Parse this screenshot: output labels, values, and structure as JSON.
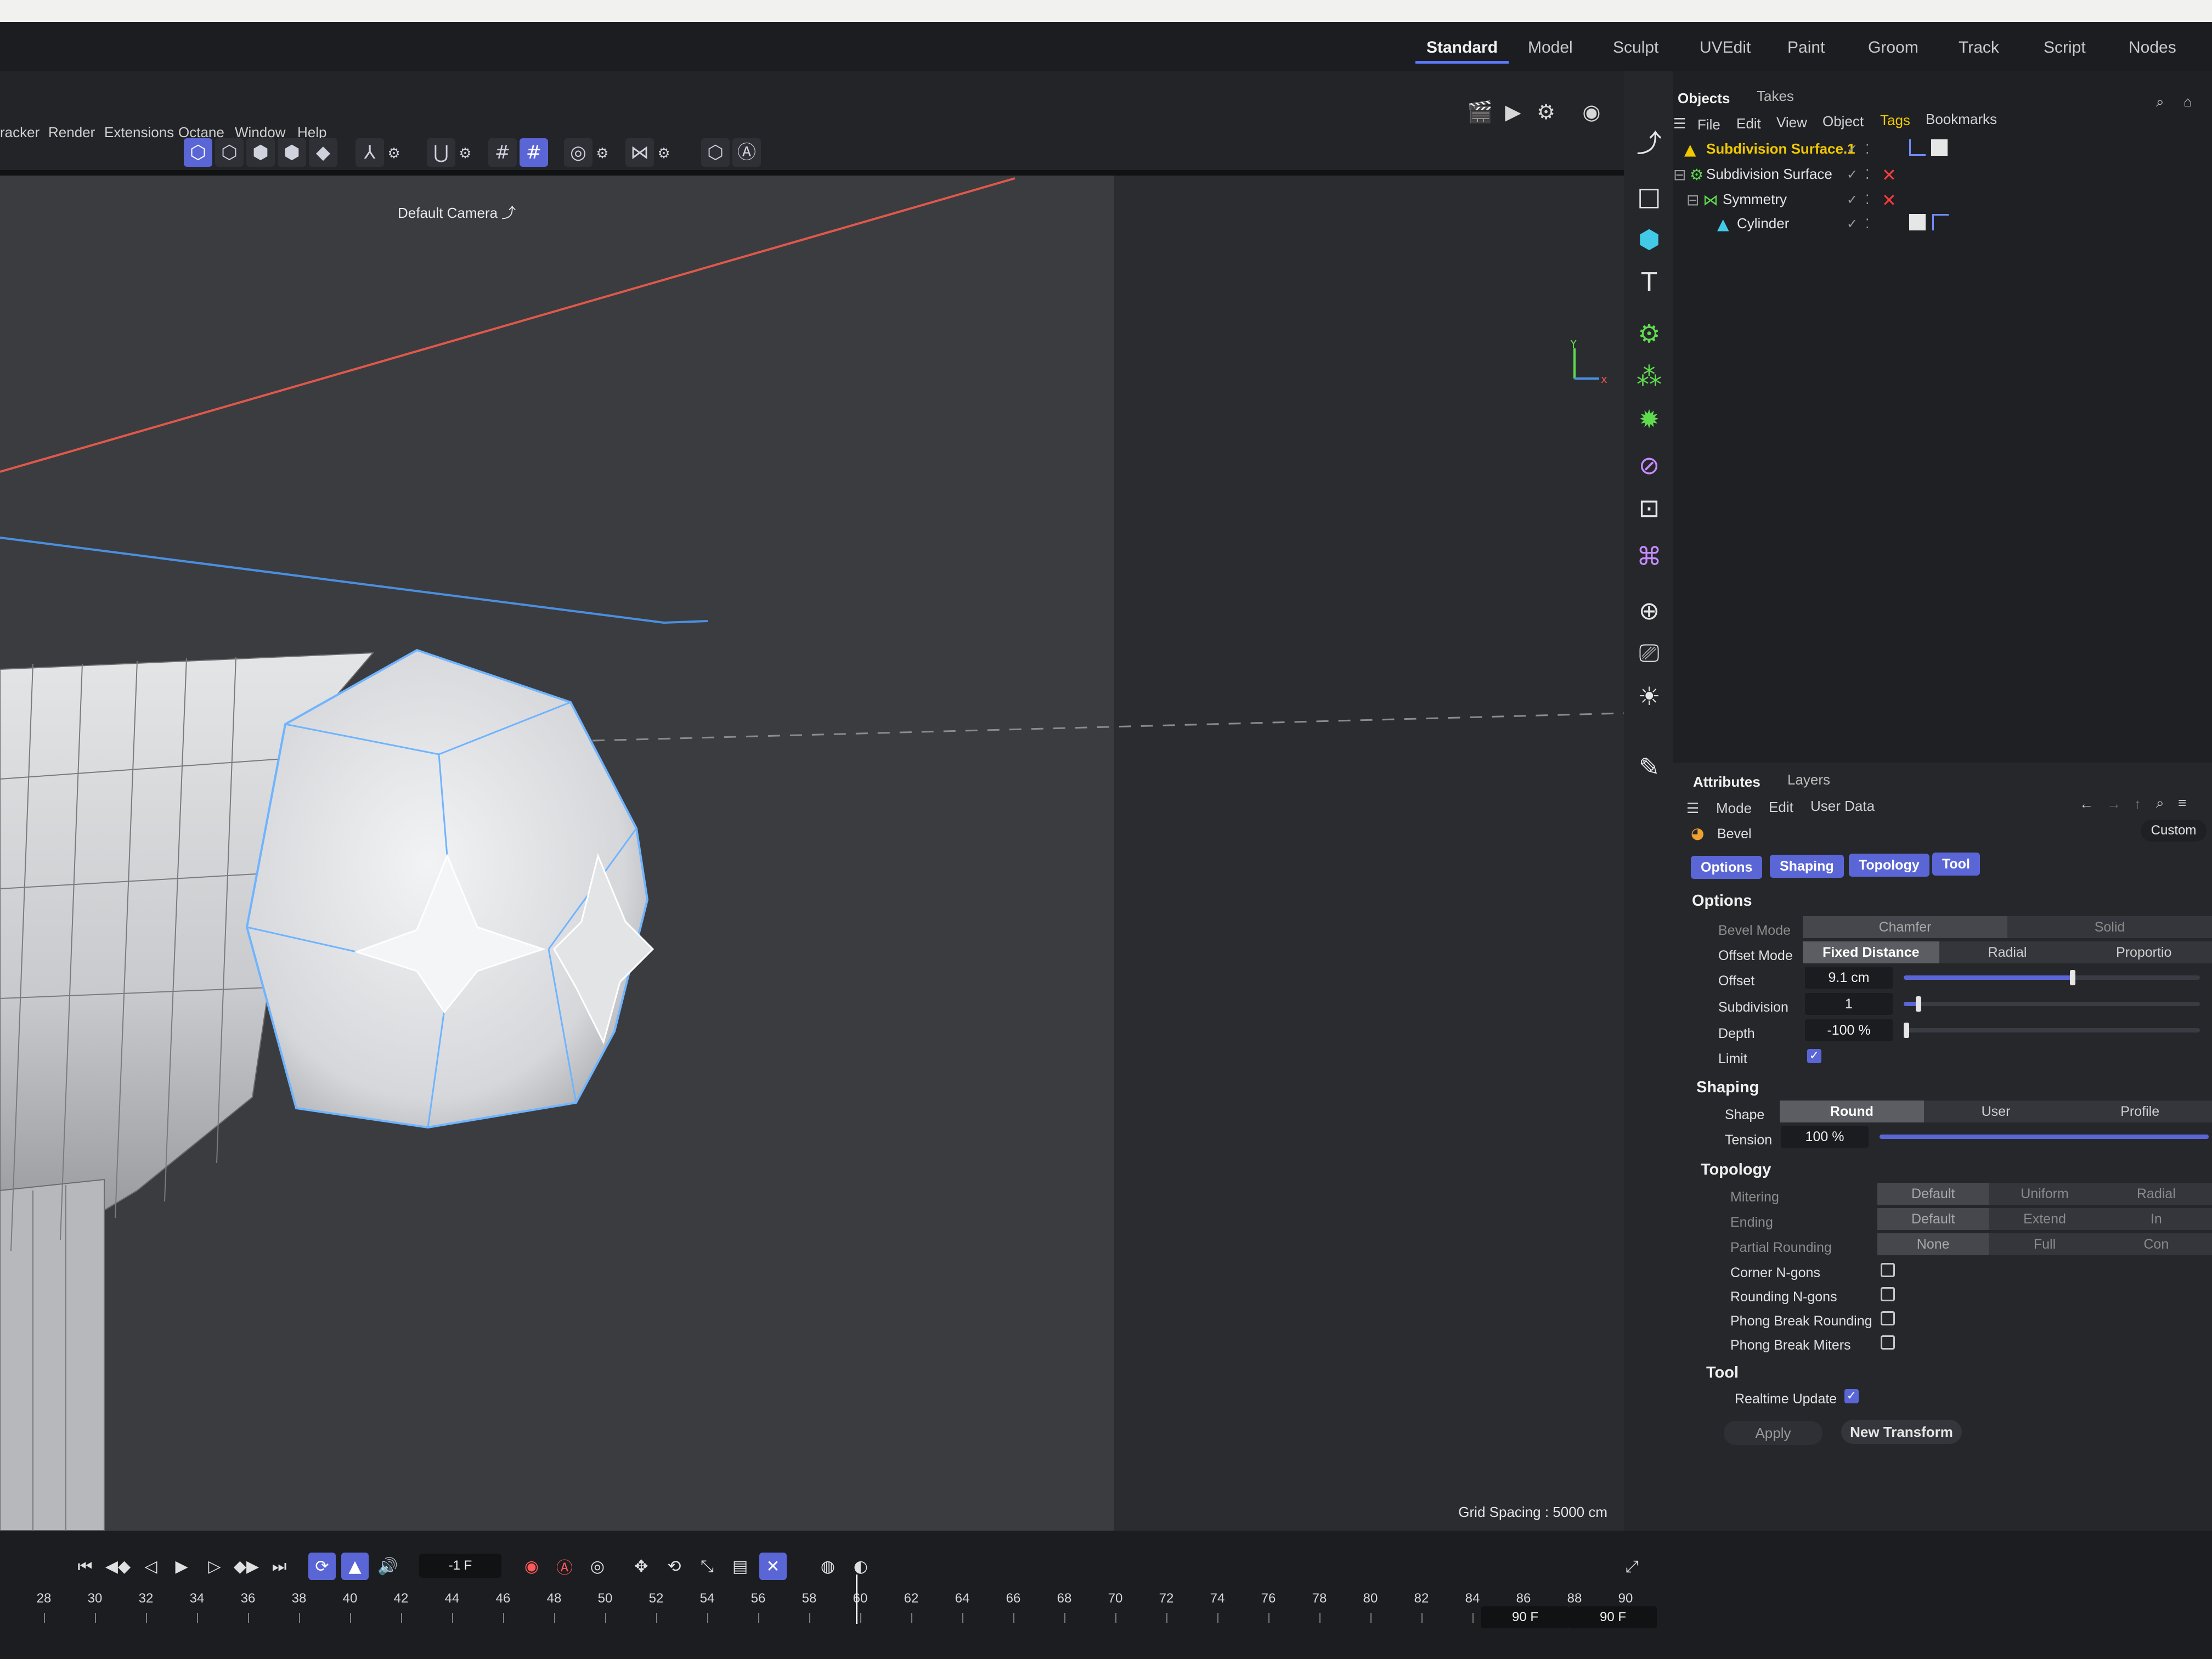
{
  "layouts": [
    "Standard",
    "Model",
    "Sculpt",
    "UVEdit",
    "Paint",
    "Groom",
    "Track",
    "Script",
    "Nodes"
  ],
  "active_layout": "Standard",
  "menubar": [
    "racker",
    "Render",
    "Extensions",
    "Octane",
    "Window",
    "Help"
  ],
  "viewport": {
    "camera": "Default Camera",
    "grid_spacing": "Grid Spacing : 5000 cm"
  },
  "objects_panel": {
    "tabs": [
      "Objects",
      "Takes"
    ],
    "menu": [
      "File",
      "Edit",
      "View",
      "Object",
      "Tags",
      "Bookmarks"
    ],
    "objects": [
      {
        "name": "Subdivision Surface.1",
        "selected": true
      },
      {
        "name": "Subdivision Surface",
        "selected": false
      },
      {
        "name": "Symmetry",
        "selected": false
      },
      {
        "name": "Cylinder",
        "selected": false
      }
    ]
  },
  "attributes": {
    "tabs": [
      "Attributes",
      "Layers"
    ],
    "menu": [
      "Mode",
      "Edit",
      "User Data"
    ],
    "mode_dropdown": "Custom",
    "tool_name": "Bevel",
    "chips": [
      "Options",
      "Shaping",
      "Topology",
      "Tool"
    ],
    "sections": {
      "options": "Options",
      "shaping": "Shaping",
      "topology": "Topology",
      "tool": "Tool"
    },
    "bevel_mode": {
      "label": "Bevel Mode",
      "options": [
        "Chamfer",
        "Solid"
      ],
      "selected": "Chamfer"
    },
    "offset_mode": {
      "label": "Offset Mode",
      "options": [
        "Fixed Distance",
        "Radial",
        "Proportio"
      ],
      "selected": "Fixed Distance"
    },
    "offset": {
      "label": "Offset",
      "value": "9.1 cm",
      "slider": 0.57
    },
    "subdivision": {
      "label": "Subdivision",
      "value": "1",
      "slider": 0.05
    },
    "depth": {
      "label": "Depth",
      "value": "-100 %",
      "slider": 0.0
    },
    "limit": {
      "label": "Limit",
      "checked": true
    },
    "shape": {
      "label": "Shape",
      "options": [
        "Round",
        "User",
        "Profile"
      ],
      "selected": "Round"
    },
    "tension": {
      "label": "Tension",
      "value": "100 %",
      "slider": 1.0
    },
    "mitering": {
      "label": "Mitering",
      "options": [
        "Default",
        "Uniform",
        "Radial"
      ],
      "selected": "Default"
    },
    "ending": {
      "label": "Ending",
      "options": [
        "Default",
        "Extend",
        "In"
      ],
      "selected": "Default"
    },
    "partial_rounding": {
      "label": "Partial Rounding",
      "options": [
        "None",
        "Full",
        "Con"
      ],
      "selected": "None"
    },
    "corner_ngons": {
      "label": "Corner N-gons",
      "checked": false
    },
    "rounding_ngons": {
      "label": "Rounding N-gons",
      "checked": false
    },
    "phong_break_rounding": {
      "label": "Phong Break Rounding",
      "checked": false
    },
    "phong_break_miters": {
      "label": "Phong Break Miters",
      "checked": false
    },
    "realtime_update": {
      "label": "Realtime Update",
      "checked": true
    },
    "apply_label": "Apply",
    "new_transform_label": "New Transform"
  },
  "timeline": {
    "current_frame": "-1 F",
    "ticks": [
      "28",
      "30",
      "32",
      "34",
      "36",
      "38",
      "40",
      "42",
      "44",
      "46",
      "48",
      "50",
      "52",
      "54",
      "56",
      "58",
      "60",
      "62",
      "64",
      "66",
      "68",
      "70",
      "72",
      "74",
      "76",
      "78",
      "80",
      "82",
      "84",
      "86",
      "88",
      "90"
    ],
    "end_frame": "90 F",
    "max_frame": "90 F"
  },
  "colors": {
    "accent": "#5a66d6",
    "selected_object": "#f0c800",
    "x_axis": "#e0584a",
    "z_axis": "#4a8fe0",
    "edge_highlight": "#6fb4ff"
  }
}
